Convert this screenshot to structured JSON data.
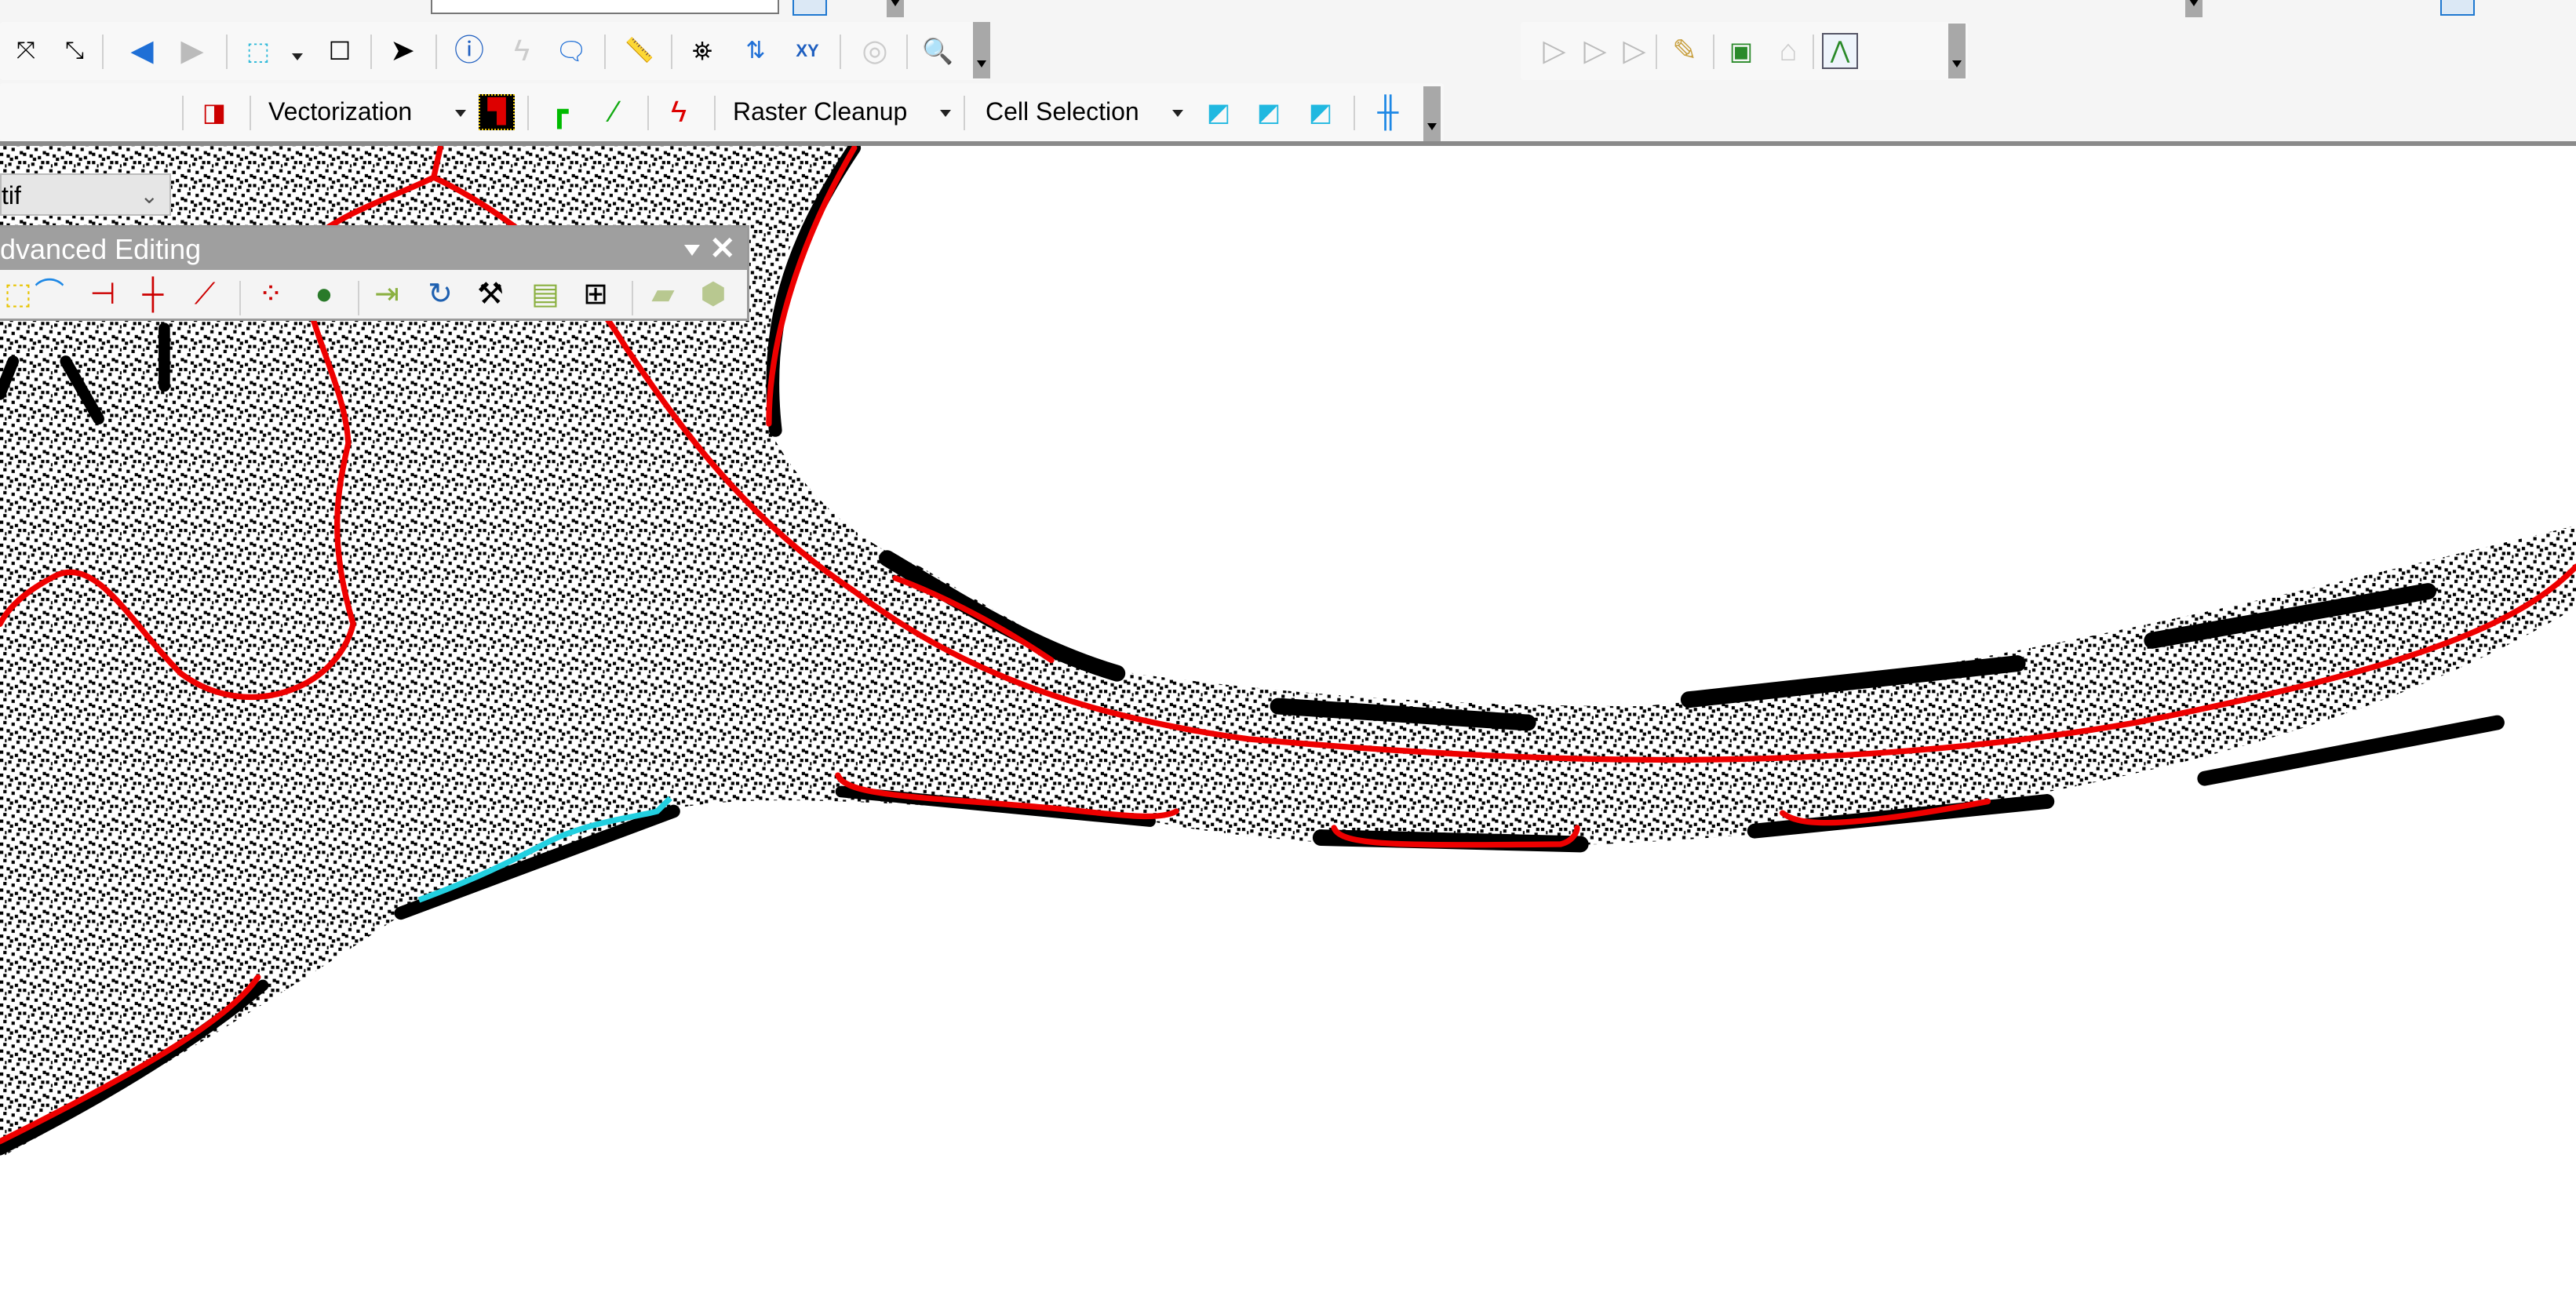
{
  "toolbar_row3": {
    "layer_combo_value": "tif",
    "vectorization_label": "Vectorization",
    "raster_cleanup_label": "Raster Cleanup",
    "cell_selection_label": "Cell Selection"
  },
  "advanced_editing": {
    "title": "dvanced Editing",
    "menu_icon": "triangle-down-icon",
    "close_icon": "close-icon"
  },
  "colors": {
    "vector_lines": "#ee0000",
    "selected_line": "#22d0e0",
    "raster": "#000000",
    "toolbar_bg": "#f5f5f5",
    "floating_title_bg": "#9f9f9f"
  }
}
